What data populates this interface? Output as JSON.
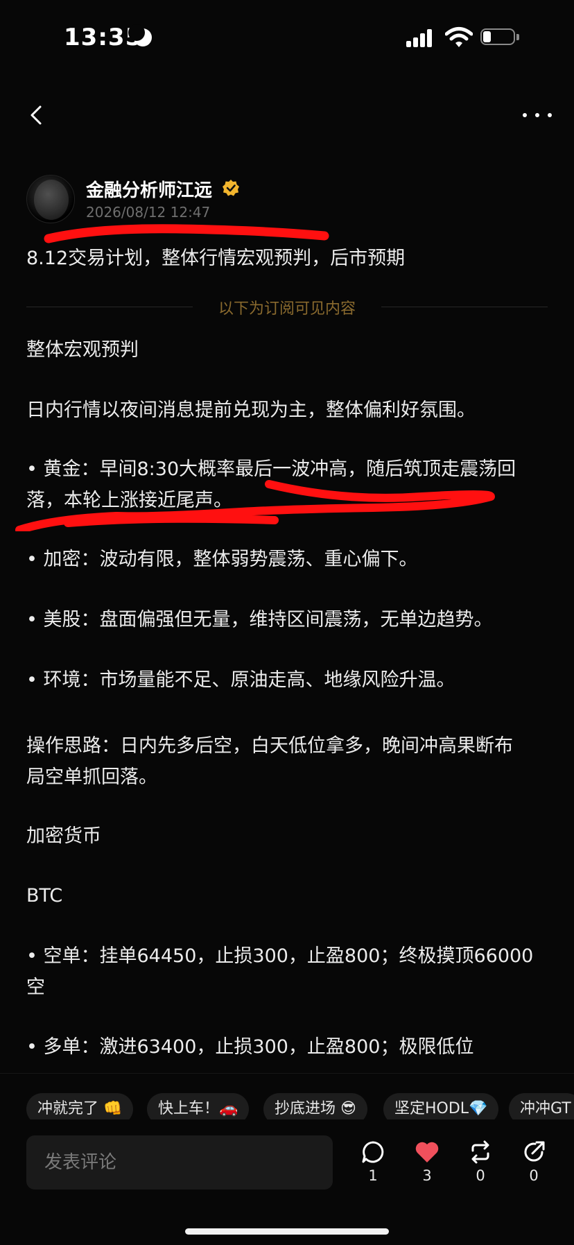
{
  "status_bar": {
    "time": "13:35"
  },
  "author": {
    "name": "金融分析师江远",
    "date": "2026/08/12 12:47"
  },
  "post": {
    "summary": "8.12交易计划，整体行情宏观预判，后市预期",
    "subscriber_divider": "以下为订阅可见内容",
    "lines": [
      "整体宏观预判",
      "日内行情以夜间消息提前兑现为主，整体偏利好氛围。",
      "• 黄金：早间8:30大概率最后一波冲高，随后筑顶走震荡回",
      "落，本轮上涨接近尾声。",
      "• 加密：波动有限，整体弱势震荡、重心偏下。",
      "• 美股：盘面偏强但无量，维持区间震荡，无单边趋势。",
      "• 环境：市场量能不足、原油走高、地缘风险升温。",
      "操作思路：日内先多后空，白天低位拿多，晚间冲高果断布",
      "局空单抓回落。",
      "加密货币",
      "BTC",
      "• 空单：挂单64450，止损300，止盈800；终极摸顶66000",
      "空",
      "• 多单：激进63400，止损300，止盈800；极限低位"
    ]
  },
  "quick_tags": [
    "冲就完了 👊",
    "快上车！🚗",
    "抄底进场 😎",
    "坚定HODL💎",
    "冲冲GT"
  ],
  "comment_box": {
    "placeholder": "发表评论"
  },
  "actions": {
    "comment_count": "1",
    "like_count": "3",
    "repost_count": "0",
    "share_count": "0"
  },
  "colors": {
    "background": "#070707",
    "like_accent": "#f0505c",
    "divider_text": "#8a6a2e",
    "verified_badge": "#f2b52e",
    "highlight_mark": "#ff1010"
  }
}
